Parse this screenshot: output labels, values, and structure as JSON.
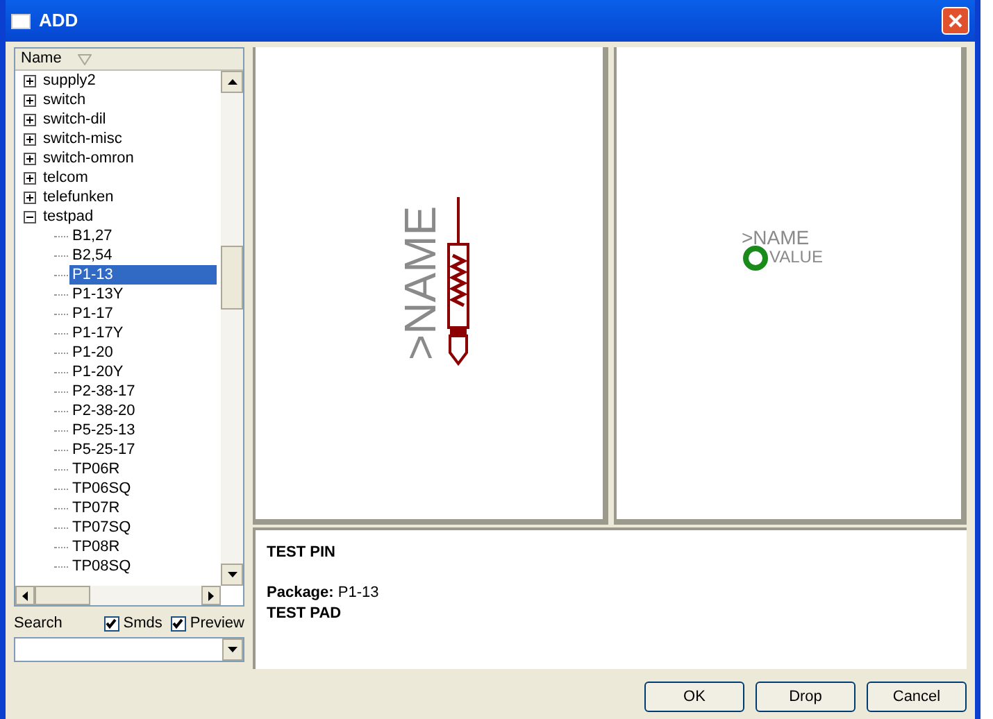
{
  "window": {
    "title": "ADD"
  },
  "tree": {
    "column": "Name",
    "items": [
      {
        "label": "supply2",
        "expanded": false,
        "selected": false
      },
      {
        "label": "switch",
        "expanded": false,
        "selected": false
      },
      {
        "label": "switch-dil",
        "expanded": false,
        "selected": false
      },
      {
        "label": "switch-misc",
        "expanded": false,
        "selected": false
      },
      {
        "label": "switch-omron",
        "expanded": false,
        "selected": false
      },
      {
        "label": "telcom",
        "expanded": false,
        "selected": false
      },
      {
        "label": "telefunken",
        "expanded": false,
        "selected": false
      },
      {
        "label": "testpad",
        "expanded": true,
        "selected": false,
        "children": [
          {
            "label": "B1,27",
            "selected": false
          },
          {
            "label": "B2,54",
            "selected": false
          },
          {
            "label": "P1-13",
            "selected": true
          },
          {
            "label": "P1-13Y",
            "selected": false
          },
          {
            "label": "P1-17",
            "selected": false
          },
          {
            "label": "P1-17Y",
            "selected": false
          },
          {
            "label": "P1-20",
            "selected": false
          },
          {
            "label": "P1-20Y",
            "selected": false
          },
          {
            "label": "P2-38-17",
            "selected": false
          },
          {
            "label": "P2-38-20",
            "selected": false
          },
          {
            "label": "P5-25-13",
            "selected": false
          },
          {
            "label": "P5-25-17",
            "selected": false
          },
          {
            "label": "TP06R",
            "selected": false
          },
          {
            "label": "TP06SQ",
            "selected": false
          },
          {
            "label": "TP07R",
            "selected": false
          },
          {
            "label": "TP07SQ",
            "selected": false
          },
          {
            "label": "TP08R",
            "selected": false
          },
          {
            "label": "TP08SQ",
            "selected": false
          }
        ]
      }
    ]
  },
  "search": {
    "label": "Search",
    "options": [
      {
        "label": "Smds",
        "checked": true
      },
      {
        "label": "Preview",
        "checked": true
      }
    ]
  },
  "symbol_preview": {
    "name_text": ">NAME"
  },
  "package_preview": {
    "name_text": ">NAME",
    "value_text": "VALUE"
  },
  "description": [
    "TEST PIN",
    "**Package:** P1-13",
    "TEST PAD"
  ],
  "buttons": [
    "OK",
    "Drop",
    "Cancel"
  ]
}
